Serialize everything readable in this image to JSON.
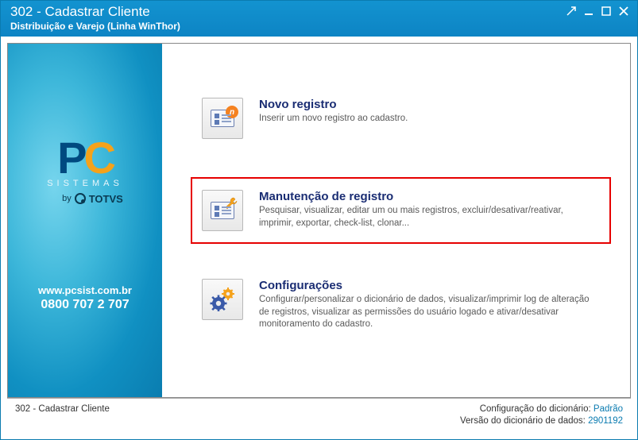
{
  "titlebar": {
    "title": "302 - Cadastrar Cliente",
    "subtitle": "Distribuição e Varejo (Linha WinThor)"
  },
  "sidebar": {
    "sistemas_label": "SISTEMAS",
    "by_label": "by",
    "totvs_label": "TOTVS",
    "url": "www.pcsist.com.br",
    "phone": "0800 707 2 707"
  },
  "options": [
    {
      "title": "Novo registro",
      "desc": "Inserir um novo registro ao cadastro.",
      "highlighted": false,
      "icon": "new-record-icon"
    },
    {
      "title": "Manutenção de registro",
      "desc": "Pesquisar, visualizar, editar um ou mais registros, excluir/desativar/reativar, imprimir, exportar, check-list,  clonar...",
      "highlighted": true,
      "icon": "maintenance-icon"
    },
    {
      "title": "Configurações",
      "desc": "Configurar/personalizar o dicionário de dados, visualizar/imprimir log de alteração de registros, visualizar as permissões do usuário logado e ativar/desativar monitoramento do cadastro.",
      "highlighted": false,
      "icon": "settings-icon"
    }
  ],
  "statusbar": {
    "left": "302 - Cadastrar Cliente",
    "config_label": "Configuração do dicionário:",
    "config_value": "Padrão",
    "version_label": "Versão do dicionário de dados:",
    "version_value": "2901192"
  }
}
